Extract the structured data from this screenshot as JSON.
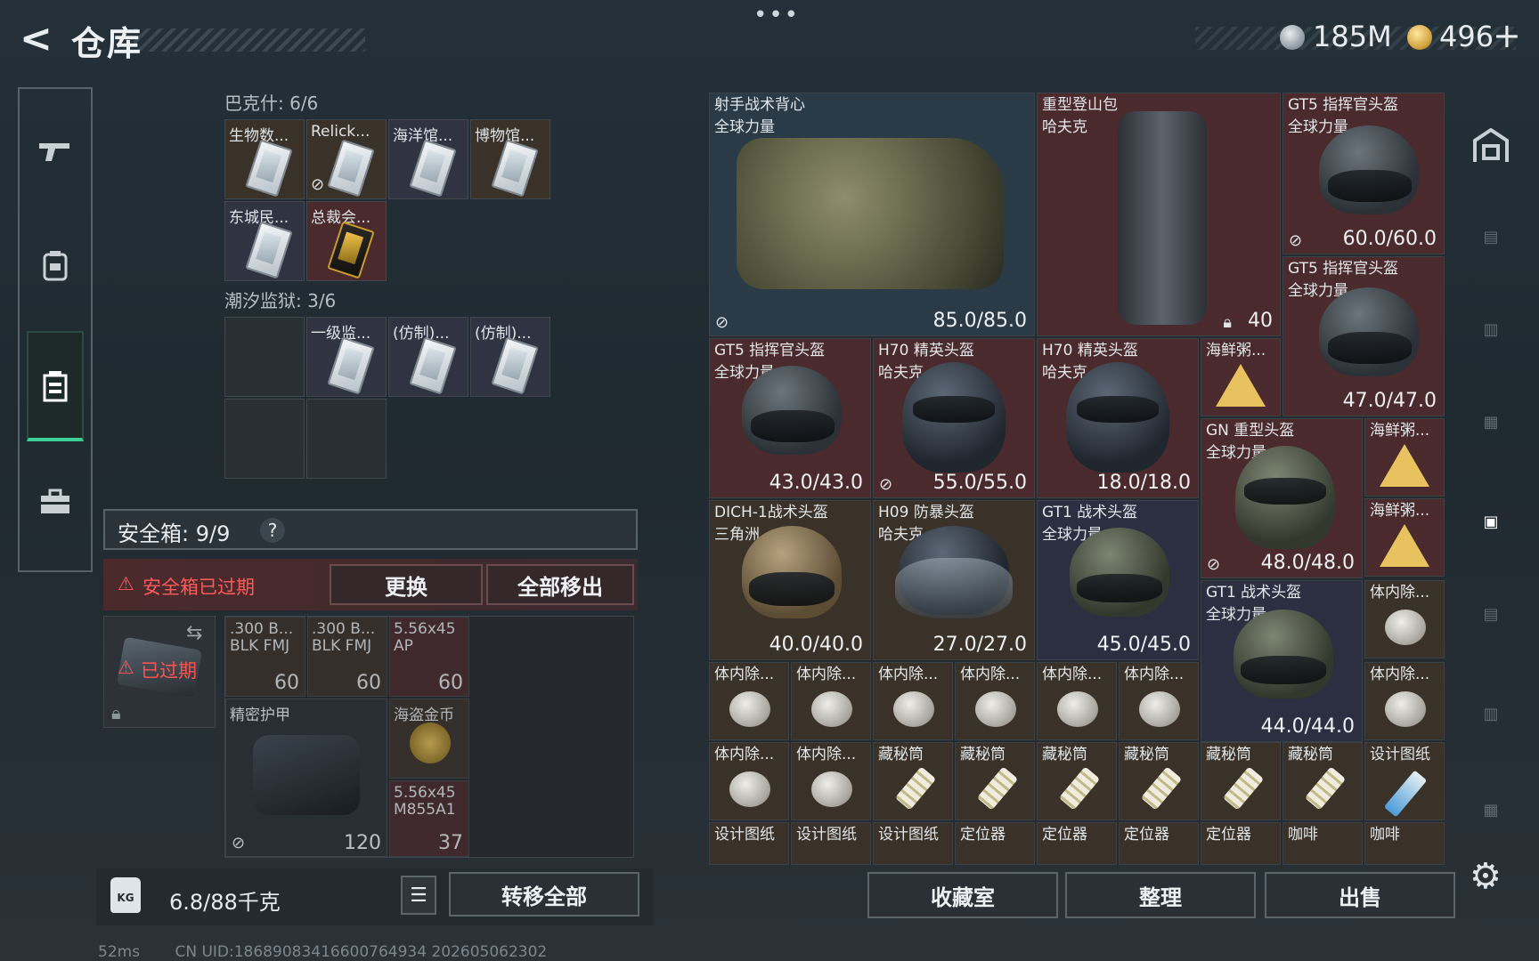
{
  "header": {
    "title": "仓库",
    "back_glyph": "<",
    "more_glyph": "•••",
    "currency1": "185M",
    "currency2": "496",
    "currency2_plus": "+"
  },
  "left": {
    "group1_title": "巴克什: 6/6",
    "group1_items": [
      "生物数...",
      "Relick...",
      "海洋馆...",
      "博物馆...",
      "东城民...",
      "总裁会..."
    ],
    "group2_title": "潮汐监狱: 3/6",
    "group2_items": [
      "一级监...",
      "(仿制)...",
      "(仿制)..."
    ],
    "safe_label": "安全箱: 9/9",
    "safe_help": "?",
    "warn_text": "安全箱已过期",
    "replace_label": "更换",
    "remove_all_label": "全部移出",
    "safebox_expired": "已过期",
    "lower_items": [
      {
        "name": ".300 B...",
        "sub": "BLK FMJ",
        "count": "60"
      },
      {
        "name": ".300 B...",
        "sub": "BLK FMJ",
        "count": "60"
      },
      {
        "name": "5.56x45",
        "sub": "AP",
        "count": "60"
      },
      {
        "name": "精密护甲",
        "count": "120"
      },
      {
        "name": "海盗金币",
        "count": ""
      },
      {
        "name": "5.56x45",
        "sub": "M855A1",
        "count": "37"
      }
    ],
    "weight": "6.8/88千克",
    "transfer_label": "转移全部"
  },
  "grid": {
    "vest": {
      "name": "射手战术背心",
      "maker": "全球力量",
      "dur": "85.0/85.0"
    },
    "backpack": {
      "name": "重型登山包",
      "maker": "哈夫克",
      "count": "40"
    },
    "h_gt5a": {
      "name": "GT5 指挥官头盔",
      "maker": "全球力量",
      "dur": "60.0/60.0"
    },
    "h_gt5b": {
      "name": "GT5 指挥官头盔",
      "maker": "全球力量",
      "dur": "47.0/47.0"
    },
    "h_gt5c": {
      "name": "GT5 指挥官头盔",
      "maker": "全球力量",
      "dur": "43.0/43.0"
    },
    "h_h70a": {
      "name": "H70 精英头盔",
      "maker": "哈夫克",
      "dur": "55.0/55.0"
    },
    "h_h70b": {
      "name": "H70 精英头盔",
      "maker": "哈夫克",
      "dur": "18.0/18.0"
    },
    "seafood1": "海鲜粥...",
    "h_gn": {
      "name": "GN 重型头盔",
      "maker": "全球力量",
      "dur": "48.0/48.0"
    },
    "seafood2": "海鲜粥...",
    "seafood3": "海鲜粥...",
    "h_dich": {
      "name": "DICH-1战术头盔",
      "maker": "三角洲",
      "dur": "40.0/40.0"
    },
    "h_h09": {
      "name": "H09 防暴头盔",
      "maker": "哈夫克",
      "dur": "27.0/27.0"
    },
    "h_gt1a": {
      "name": "GT1 战术头盔",
      "maker": "全球力量",
      "dur": "45.0/45.0"
    },
    "h_gt1b": {
      "name": "GT1 战术头盔",
      "maker": "全球力量",
      "dur": "44.0/44.0"
    },
    "small_row1": [
      "体内除...",
      "体内除...",
      "体内除...",
      "体内除...",
      "体内除...",
      "体内除...",
      "体内除...",
      "体内除..."
    ],
    "small_row2": [
      "体内除...",
      "体内除...",
      "藏秘筒",
      "藏秘筒",
      "藏秘筒",
      "藏秘筒",
      "藏秘筒",
      "藏秘筒",
      "设计图纸"
    ],
    "small_row3": [
      "设计图纸",
      "设计图纸",
      "设计图纸",
      "定位器",
      "定位器",
      "定位器",
      "定位器",
      "咖啡",
      "咖啡"
    ]
  },
  "bottom": {
    "collection": "收藏室",
    "sort": "整理",
    "sell": "出售"
  },
  "status": {
    "ping": "52ms",
    "uid": "CN UID:18689083416600764934 202605062302"
  },
  "colors": {
    "accent_green": "#3ccf95",
    "warn_red": "#ff5a5a",
    "cell_red": "#4b2a2d",
    "cell_gold": "#3a3128"
  }
}
